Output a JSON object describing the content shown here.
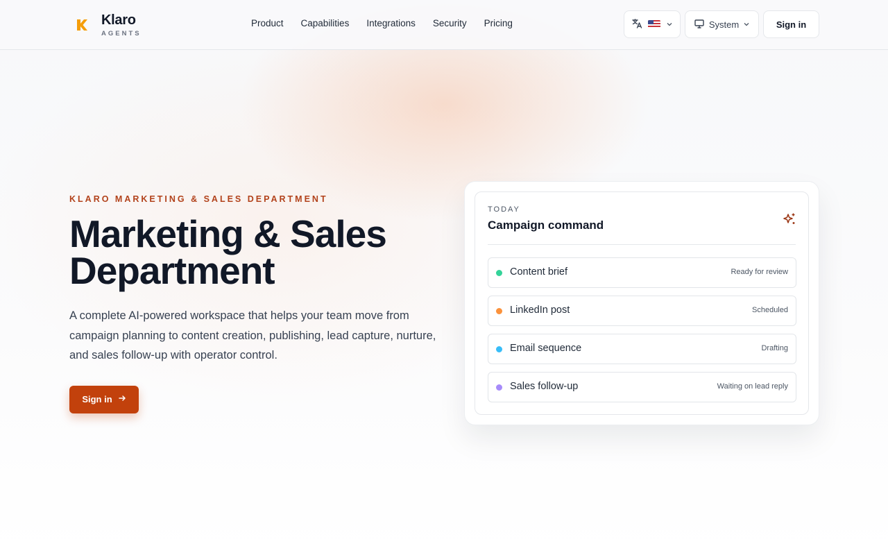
{
  "brand": {
    "name": "Klaro",
    "sub": "AGENTS",
    "accent": "#f59e0b"
  },
  "nav": {
    "items": [
      "Product",
      "Capabilities",
      "Integrations",
      "Security",
      "Pricing"
    ]
  },
  "header": {
    "language_icon": "translate-icon",
    "flag": "us-flag",
    "theme_label": "System",
    "sign_in": "Sign in"
  },
  "hero": {
    "eyebrow": "KLARO MARKETING & SALES DEPARTMENT",
    "title_line1": "Marketing & Sales",
    "title_line2": "Department",
    "description": "A complete AI-powered workspace that helps your team move from campaign planning to content creation, publishing, lead capture, nurture, and sales follow-up with operator control.",
    "cta_label": "Sign in",
    "cta_color": "#c2410c"
  },
  "card": {
    "kicker": "TODAY",
    "title": "Campaign command",
    "icon": "sparkles-icon",
    "items": [
      {
        "label": "Content brief",
        "status": "Ready for review",
        "color": "#34d399"
      },
      {
        "label": "LinkedIn post",
        "status": "Scheduled",
        "color": "#fb923c"
      },
      {
        "label": "Email sequence",
        "status": "Drafting",
        "color": "#38bdf8"
      },
      {
        "label": "Sales follow-up",
        "status": "Waiting on lead reply",
        "color": "#a78bfa"
      }
    ]
  }
}
